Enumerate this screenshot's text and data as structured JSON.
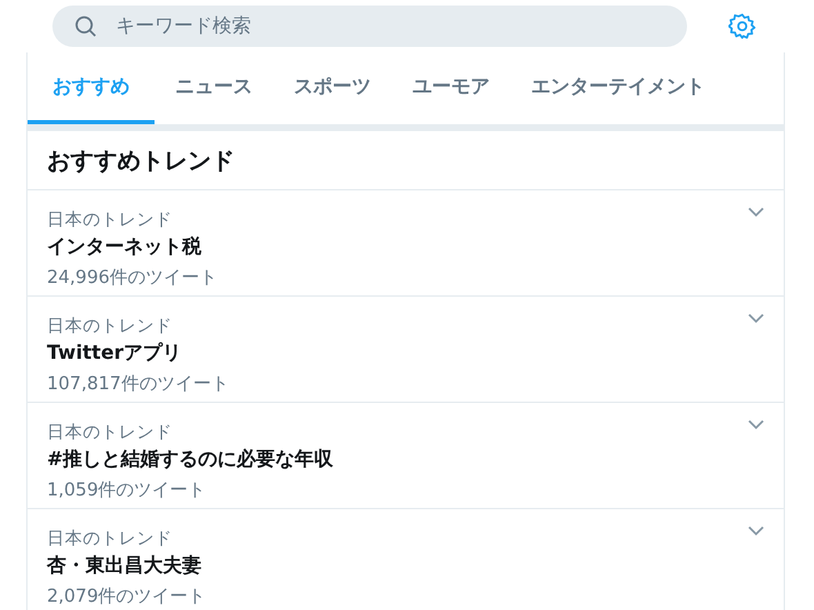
{
  "search": {
    "placeholder": "キーワード検索"
  },
  "tabs": [
    {
      "label": "おすすめ",
      "selected": true
    },
    {
      "label": "ニュース",
      "selected": false
    },
    {
      "label": "スポーツ",
      "selected": false
    },
    {
      "label": "ユーモア",
      "selected": false
    },
    {
      "label": "エンターテイメント",
      "selected": false
    }
  ],
  "section_title": "おすすめトレンド",
  "trends": [
    {
      "context": "日本のトレンド",
      "name": "インターネット税",
      "count": "24,996件のツイート"
    },
    {
      "context": "日本のトレンド",
      "name": "Twitterアプリ",
      "count": "107,817件のツイート"
    },
    {
      "context": "日本のトレンド",
      "name": "#推しと結婚するのに必要な年収",
      "count": "1,059件のツイート"
    },
    {
      "context": "日本のトレンド",
      "name": "杏・東出昌大夫妻",
      "count": "2,079件のツイート"
    }
  ]
}
